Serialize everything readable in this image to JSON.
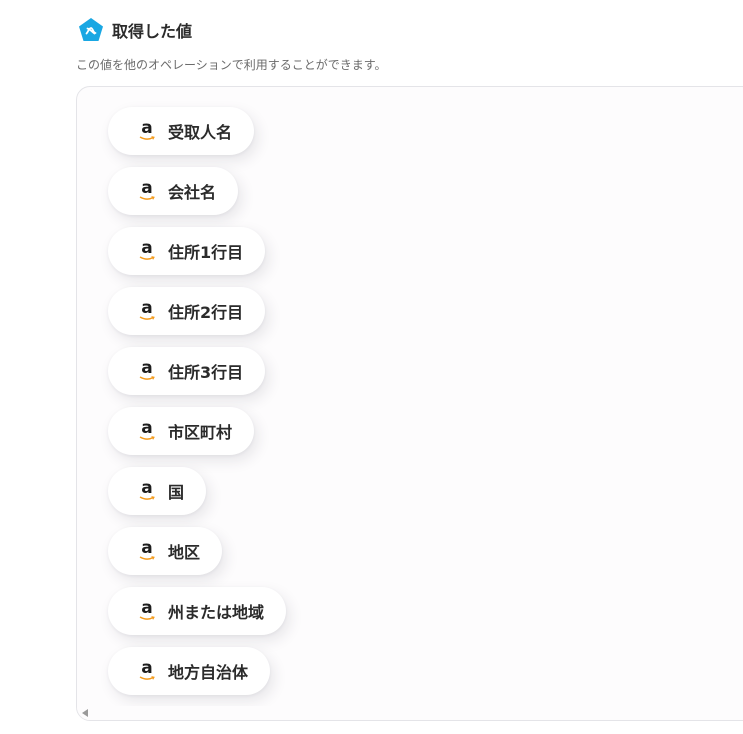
{
  "header": {
    "logo_icon": "yoom-pentagon-icon",
    "title": "取得した値",
    "description": "この値を他のオペレーションで利用することができます。"
  },
  "colors": {
    "logo_bg": "#19a7e3",
    "amazon_arrow": "#f49b1c"
  },
  "chips": [
    {
      "icon": "amazon-icon",
      "label": "受取人名"
    },
    {
      "icon": "amazon-icon",
      "label": "会社名"
    },
    {
      "icon": "amazon-icon",
      "label": "住所1行目"
    },
    {
      "icon": "amazon-icon",
      "label": "住所2行目"
    },
    {
      "icon": "amazon-icon",
      "label": "住所3行目"
    },
    {
      "icon": "amazon-icon",
      "label": "市区町村"
    },
    {
      "icon": "amazon-icon",
      "label": "国"
    },
    {
      "icon": "amazon-icon",
      "label": "地区"
    },
    {
      "icon": "amazon-icon",
      "label": "州または地域"
    },
    {
      "icon": "amazon-icon",
      "label": "地方自治体"
    }
  ]
}
